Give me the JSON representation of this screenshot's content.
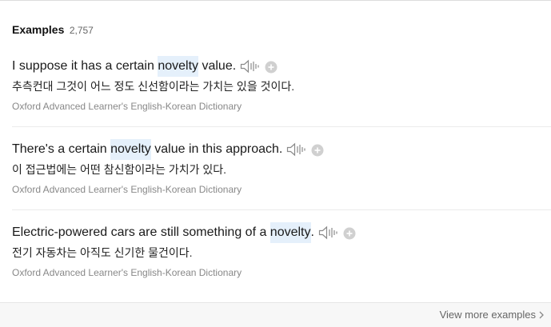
{
  "header": {
    "title": "Examples",
    "count": "2,757"
  },
  "examples": [
    {
      "sentence_pre": "I suppose it has a certain ",
      "keyword": "novelty",
      "sentence_post": " value.",
      "translation": "추측컨대 그것이 어느 정도 신선함이라는 가치는 있을 것이다.",
      "source": "Oxford Advanced Learner's English-Korean Dictionary"
    },
    {
      "sentence_pre": "There's a certain ",
      "keyword": "novelty",
      "sentence_post": " value in this approach.",
      "translation": "이 접근법에는 어떤 참신함이라는 가치가 있다.",
      "source": "Oxford Advanced Learner's English-Korean Dictionary"
    },
    {
      "sentence_pre": "Electric-powered cars are still something of a ",
      "keyword": "novelty",
      "sentence_post": ".",
      "translation": "전기 자동차는 아직도 신기한 물건이다.",
      "source": "Oxford Advanced Learner's English-Korean Dictionary"
    }
  ],
  "footer": {
    "more_label": "View more examples"
  },
  "icons": {
    "speaker": "speaker-icon",
    "add": "plus-icon",
    "more": "chevron-right-icon"
  },
  "colors": {
    "highlight": "#e5f0fb",
    "icon": "#8a8a8a",
    "plus_bg": "#d0d0d0",
    "source_text": "#888888"
  }
}
